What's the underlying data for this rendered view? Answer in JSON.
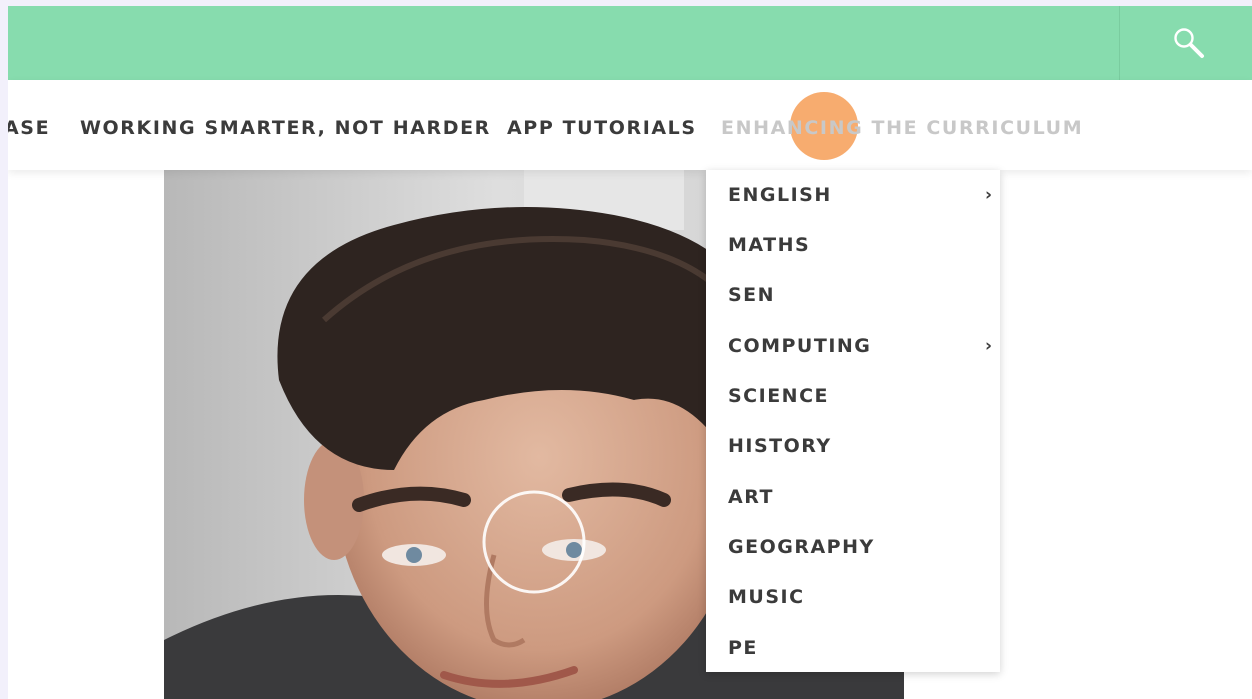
{
  "nav": {
    "items": [
      {
        "label": "ASE",
        "state": "normal"
      },
      {
        "label": "WORKING SMARTER, NOT HARDER",
        "state": "normal"
      },
      {
        "label": "APP TUTORIALS",
        "state": "normal"
      },
      {
        "label": "ENHANCING THE CURRICULUM",
        "state": "hover"
      }
    ],
    "search_icon": "search-icon"
  },
  "dropdown": {
    "items": [
      {
        "label": "ENGLISH",
        "submenu": true
      },
      {
        "label": "MATHS",
        "submenu": false
      },
      {
        "label": "SEN",
        "submenu": false
      },
      {
        "label": "COMPUTING",
        "submenu": true
      },
      {
        "label": "SCIENCE",
        "submenu": false
      },
      {
        "label": "HISTORY",
        "submenu": false
      },
      {
        "label": "ART",
        "submenu": false
      },
      {
        "label": "GEOGRAPHY",
        "submenu": false
      },
      {
        "label": "MUSIC",
        "submenu": false
      },
      {
        "label": "PE",
        "submenu": false
      }
    ],
    "arrow": "›"
  },
  "colors": {
    "topbar": "#87dcae",
    "nav_text": "#3b3b3b",
    "nav_active": "#c8c8c8",
    "click_indicator": "#f6a35f"
  }
}
